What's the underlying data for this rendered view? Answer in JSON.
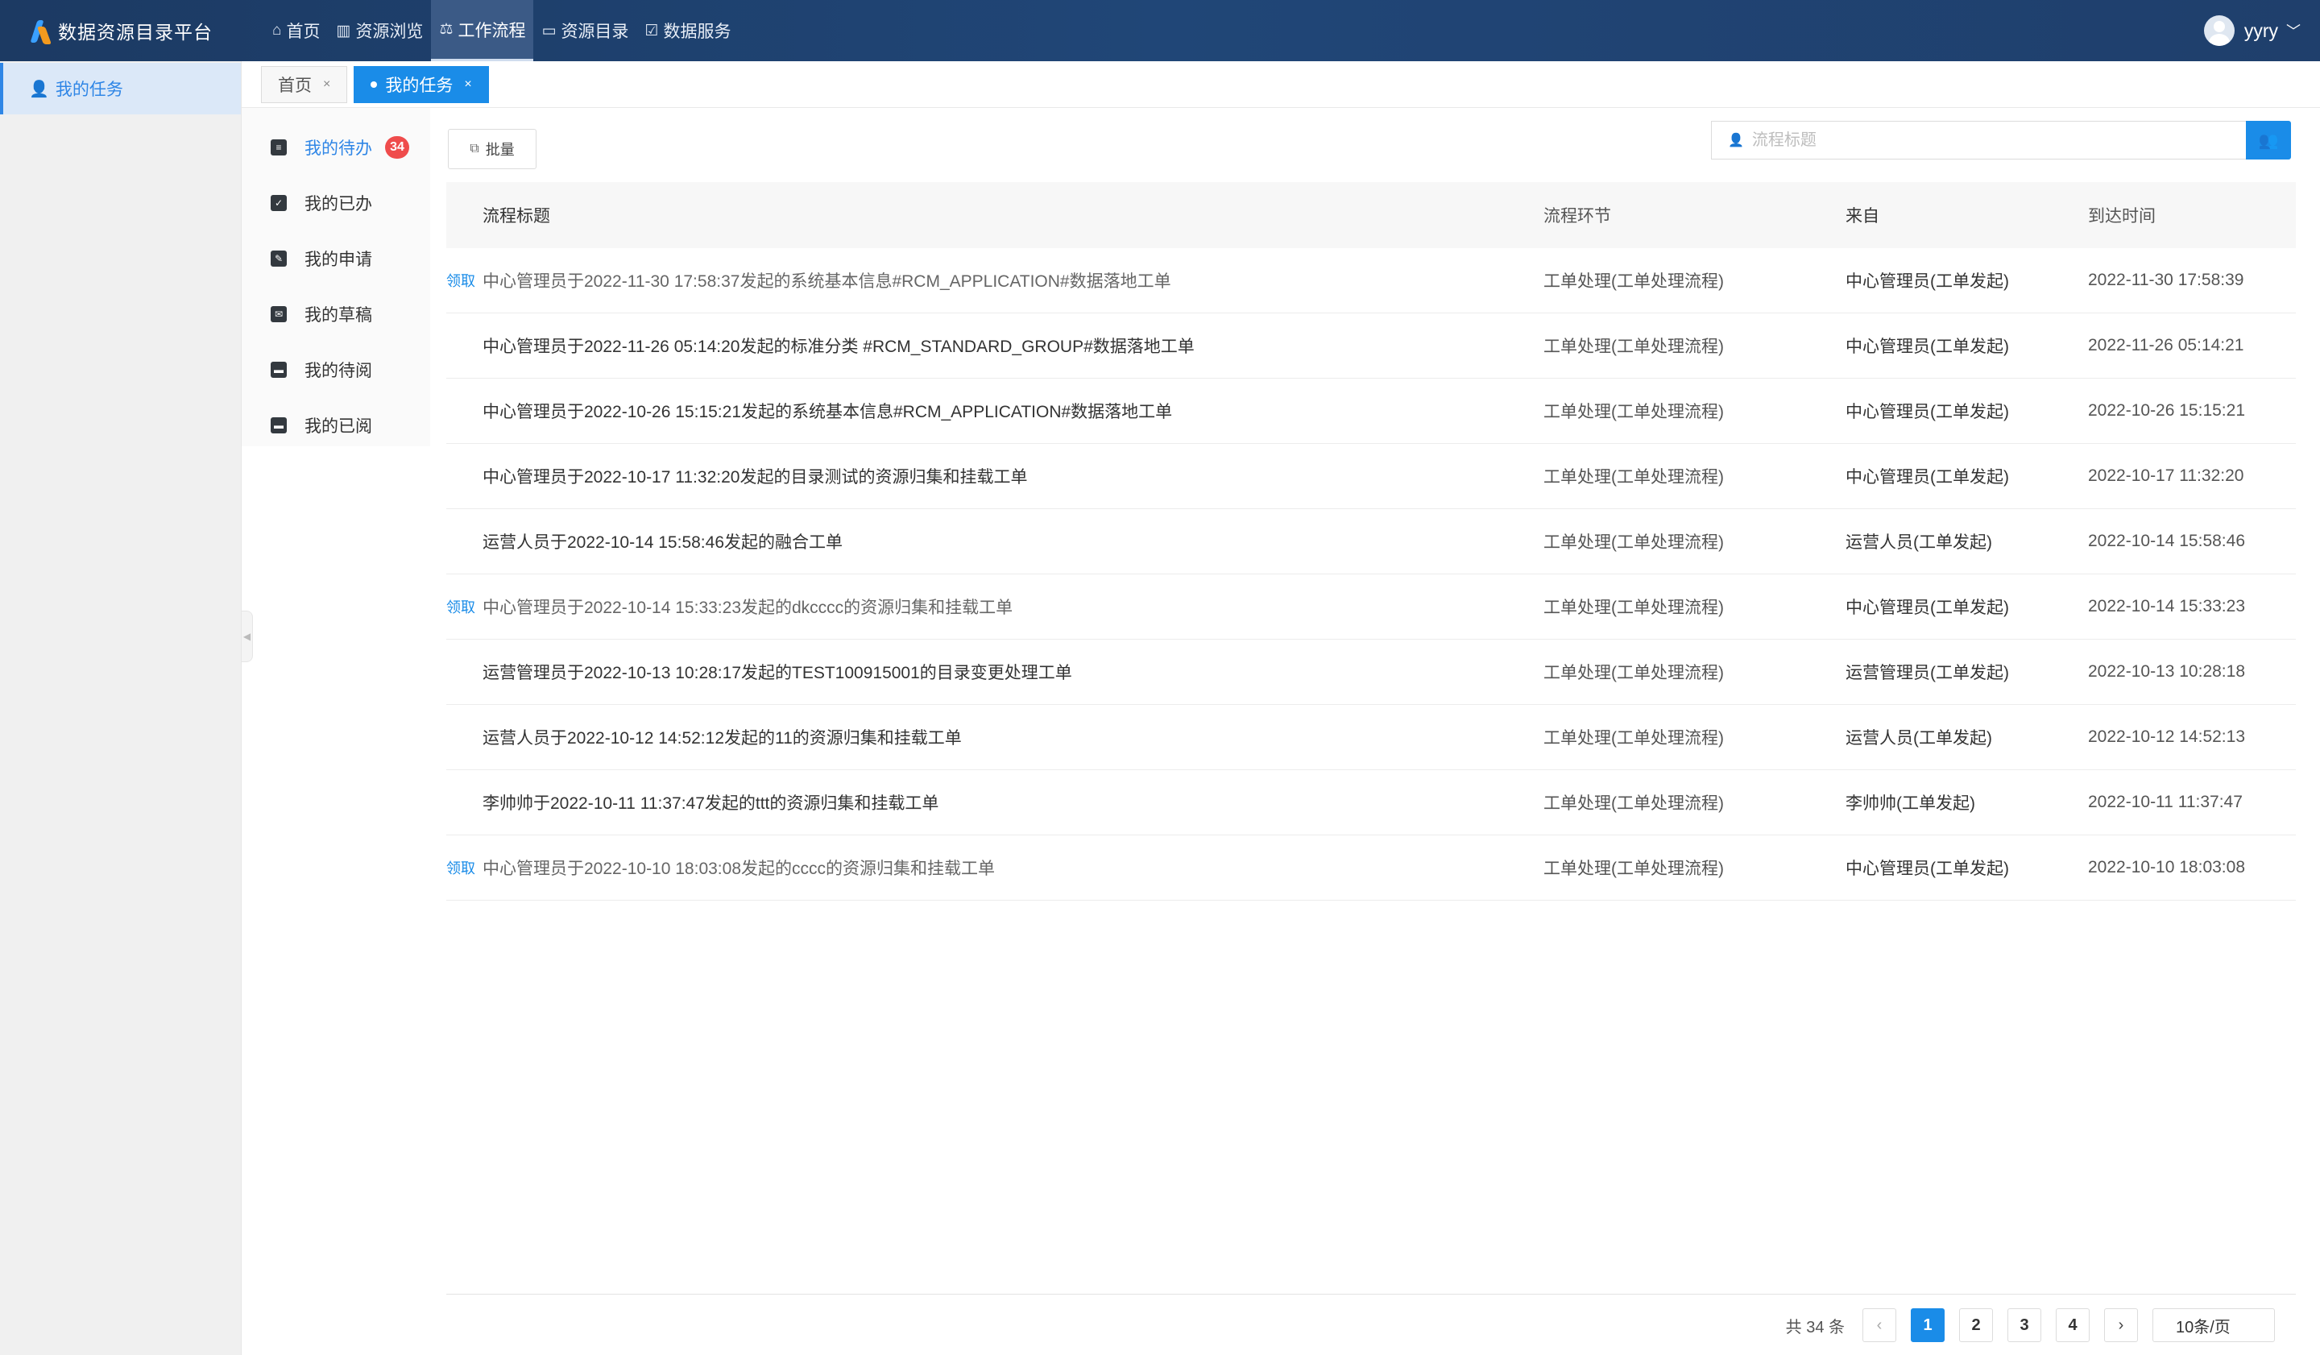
{
  "app": {
    "title": "数据资源目录平台"
  },
  "nav": [
    {
      "label": "首页",
      "icon": "home-icon",
      "active": false
    },
    {
      "label": "资源浏览",
      "icon": "book-icon",
      "active": false
    },
    {
      "label": "工作流程",
      "icon": "workflow-icon",
      "active": true
    },
    {
      "label": "资源目录",
      "icon": "folder-icon",
      "active": false
    },
    {
      "label": "数据服务",
      "icon": "service-icon",
      "active": false
    }
  ],
  "user": {
    "name": "yyry"
  },
  "sidebar": {
    "items": [
      {
        "label": "我的任务",
        "icon": "user-icon"
      }
    ]
  },
  "tabs": [
    {
      "label": "首页",
      "active": false
    },
    {
      "label": "我的任务",
      "active": true
    }
  ],
  "submenu": [
    {
      "label": "我的待办",
      "badge": "34",
      "active": true
    },
    {
      "label": "我的已办",
      "active": false
    },
    {
      "label": "我的申请",
      "active": false
    },
    {
      "label": "我的草稿",
      "active": false
    },
    {
      "label": "我的待阅",
      "active": false
    },
    {
      "label": "我的已阅",
      "active": false
    }
  ],
  "toolbar": {
    "batch_label": "批量"
  },
  "search": {
    "placeholder": "流程标题",
    "value": ""
  },
  "table": {
    "columns": [
      "流程标题",
      "流程环节",
      "来自",
      "到达时间"
    ],
    "claim_label": "领取",
    "rows": [
      {
        "claim": true,
        "title": "中心管理员于2022-11-30 17:58:37发起的系统基本信息#RCM_APPLICATION#数据落地工单",
        "node": "工单处理(工单处理流程)",
        "from": "中心管理员(工单发起)",
        "time": "2022-11-30 17:58:39"
      },
      {
        "claim": false,
        "title": "中心管理员于2022-11-26 05:14:20发起的标准分类 #RCM_STANDARD_GROUP#数据落地工单",
        "node": "工单处理(工单处理流程)",
        "from": "中心管理员(工单发起)",
        "time": "2022-11-26 05:14:21"
      },
      {
        "claim": false,
        "title": "中心管理员于2022-10-26 15:15:21发起的系统基本信息#RCM_APPLICATION#数据落地工单",
        "node": "工单处理(工单处理流程)",
        "from": "中心管理员(工单发起)",
        "time": "2022-10-26 15:15:21"
      },
      {
        "claim": false,
        "title": "中心管理员于2022-10-17 11:32:20发起的目录测试的资源归集和挂载工单",
        "node": "工单处理(工单处理流程)",
        "from": "中心管理员(工单发起)",
        "time": "2022-10-17 11:32:20"
      },
      {
        "claim": false,
        "title": "运营人员于2022-10-14 15:58:46发起的融合工单",
        "node": "工单处理(工单处理流程)",
        "from": "运营人员(工单发起)",
        "time": "2022-10-14 15:58:46"
      },
      {
        "claim": true,
        "title": "中心管理员于2022-10-14 15:33:23发起的dkcccc的资源归集和挂载工单",
        "node": "工单处理(工单处理流程)",
        "from": "中心管理员(工单发起)",
        "time": "2022-10-14 15:33:23"
      },
      {
        "claim": false,
        "title": "运营管理员于2022-10-13 10:28:17发起的TEST100915001的目录变更处理工单",
        "node": "工单处理(工单处理流程)",
        "from": "运营管理员(工单发起)",
        "time": "2022-10-13 10:28:18"
      },
      {
        "claim": false,
        "title": "运营人员于2022-10-12 14:52:12发起的11的资源归集和挂载工单",
        "node": "工单处理(工单处理流程)",
        "from": "运营人员(工单发起)",
        "time": "2022-10-12 14:52:13"
      },
      {
        "claim": false,
        "title": "李帅帅于2022-10-11 11:37:47发起的ttt的资源归集和挂载工单",
        "node": "工单处理(工单处理流程)",
        "from": "李帅帅(工单发起)",
        "time": "2022-10-11 11:37:47"
      },
      {
        "claim": true,
        "title": "中心管理员于2022-10-10 18:03:08发起的cccc的资源归集和挂载工单",
        "node": "工单处理(工单处理流程)",
        "from": "中心管理员(工单发起)",
        "time": "2022-10-10 18:03:08"
      }
    ]
  },
  "pagination": {
    "total_label": "共 34 条",
    "pages": [
      "1",
      "2",
      "3",
      "4"
    ],
    "current": "1",
    "page_size": "10条/页"
  },
  "colors": {
    "accent": "#1a8ce8",
    "header": "#204677",
    "badge": "#ef4c4c"
  }
}
